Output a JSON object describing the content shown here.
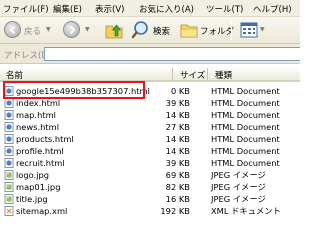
{
  "menu": {
    "items": [
      "ファイル(F)",
      "編集(E)",
      "表示(V)",
      "お気に入り(A)",
      "ツール(T)",
      "ヘルプ(H)"
    ]
  },
  "toolbar": {
    "back_label": "戻る",
    "search_label": "検索",
    "folders_label": "フォルダ"
  },
  "address": {
    "label": "アドレス(D)",
    "value": ""
  },
  "list": {
    "columns": [
      "名前",
      "サイズ",
      "種類"
    ],
    "rows": [
      {
        "name": "google15e499b38b357307.html",
        "size": "0 KB",
        "type": "HTML Document",
        "icon": "html-file-icon"
      },
      {
        "name": "index.html",
        "size": "39 KB",
        "type": "HTML Document",
        "icon": "html-file-icon"
      },
      {
        "name": "map.html",
        "size": "14 KB",
        "type": "HTML Document",
        "icon": "html-file-icon"
      },
      {
        "name": "news.html",
        "size": "27 KB",
        "type": "HTML Document",
        "icon": "html-file-icon"
      },
      {
        "name": "products.html",
        "size": "14 KB",
        "type": "HTML Document",
        "icon": "html-file-icon"
      },
      {
        "name": "profile.html",
        "size": "14 KB",
        "type": "HTML Document",
        "icon": "html-file-icon"
      },
      {
        "name": "recruit.html",
        "size": "39 KB",
        "type": "HTML Document",
        "icon": "html-file-icon"
      },
      {
        "name": "logo.jpg",
        "size": "69 KB",
        "type": "JPEG イメージ",
        "icon": "jpeg-file-icon"
      },
      {
        "name": "map01.jpg",
        "size": "82 KB",
        "type": "JPEG イメージ",
        "icon": "jpeg-file-icon"
      },
      {
        "name": "title.jpg",
        "size": "16 KB",
        "type": "JPEG イメージ",
        "icon": "jpeg-file-icon"
      },
      {
        "name": "sitemap.xml",
        "size": "192 KB",
        "type": "XML ドキュメント",
        "icon": "xml-file-icon"
      }
    ]
  },
  "colors": {
    "highlight_border": "#e8141b",
    "chrome_bg": "#ece9d8"
  }
}
